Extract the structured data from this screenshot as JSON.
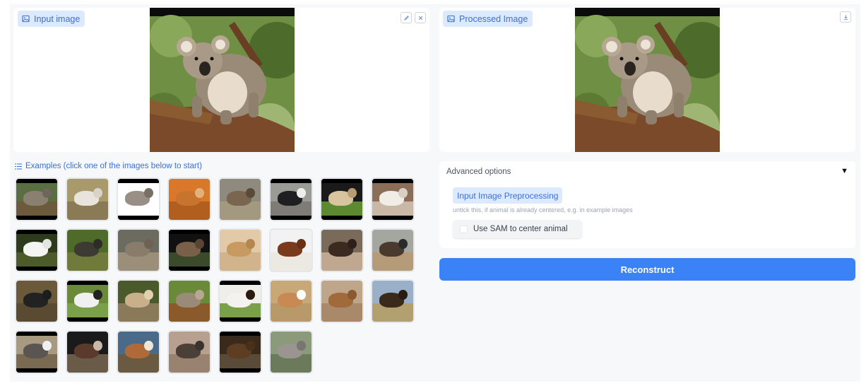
{
  "input_panel": {
    "label": "Input image",
    "icon": "image-icon",
    "edit_icon": "pencil-icon",
    "clear_icon": "close-icon"
  },
  "output_panel": {
    "label": "Processed Image",
    "icon": "image-icon",
    "download_icon": "download-icon"
  },
  "examples": {
    "label": "Examples (click one of the images below to start)",
    "icon": "list-icon",
    "items": [
      {
        "name": "boar",
        "sky": "#5a6e44",
        "ground": "#6b5a3c",
        "body": "#8a8070",
        "head": "#6e665c",
        "bars": true
      },
      {
        "name": "sheep",
        "sky": "#a89a6b",
        "ground": "#8a7a55",
        "body": "#e8e4dc",
        "head": "#d8d2c8",
        "bars": false
      },
      {
        "name": "anteater",
        "sky": "#ffffff",
        "ground": "#ffffff",
        "body": "#9a8f85",
        "head": "#7a6f65",
        "bars": true
      },
      {
        "name": "weasel",
        "sky": "#d9772a",
        "ground": "#b15e1f",
        "body": "#c8742e",
        "head": "#e3b27c",
        "bars": false
      },
      {
        "name": "bighorn",
        "sky": "#8f8a7e",
        "ground": "#a39880",
        "body": "#7a6650",
        "head": "#5a4a38",
        "bars": false
      },
      {
        "name": "dog",
        "sky": "#9a9a96",
        "ground": "#7f7c77",
        "body": "#1f1f22",
        "head": "#eeeeee",
        "bars": true
      },
      {
        "name": "zebra-foal",
        "sky": "#1a1a1a",
        "ground": "#5c8a30",
        "body": "#d9c4a0",
        "head": "#b89d74",
        "bars": true
      },
      {
        "name": "goat",
        "sky": "#8a6e5a",
        "ground": "#c9b8a6",
        "body": "#f1ece6",
        "head": "#d9cfc4",
        "bars": true
      },
      {
        "name": "mountain-goat",
        "sky": "#2e3a1c",
        "ground": "#4d5a2a",
        "body": "#f4f4f2",
        "head": "#e4e4e0",
        "bars": true
      },
      {
        "name": "buffalo",
        "sky": "#4f6b2a",
        "ground": "#6f7a3b",
        "body": "#3c3a32",
        "head": "#2e2c26",
        "bars": false
      },
      {
        "name": "wolf",
        "sky": "#6b6b60",
        "ground": "#9b8f7a",
        "body": "#8a7c6a",
        "head": "#6f6253",
        "bars": false
      },
      {
        "name": "capybara",
        "sky": "#111111",
        "ground": "#3a4a2a",
        "body": "#7a6048",
        "head": "#5a4434",
        "bars": true
      },
      {
        "name": "prairie-dog",
        "sky": "#e2c9a8",
        "ground": "#d2b48c",
        "body": "#c79a62",
        "head": "#b3874f",
        "bars": false
      },
      {
        "name": "setter",
        "sky": "#f2f2f2",
        "ground": "#ece8e2",
        "body": "#7a3a1c",
        "head": "#6a2f14",
        "bars": false
      },
      {
        "name": "otter",
        "sky": "#7a6a5a",
        "ground": "#c0a890",
        "body": "#3a2a20",
        "head": "#2e2018",
        "bars": false
      },
      {
        "name": "ostrich",
        "sky": "#a6a6a0",
        "ground": "#b59b78",
        "body": "#4a3a2e",
        "head": "#2a2a2a",
        "bars": false
      },
      {
        "name": "tapir",
        "sky": "#6a5a3a",
        "ground": "#5a4a32",
        "body": "#222222",
        "head": "#1c1c1c",
        "bars": false
      },
      {
        "name": "zebra",
        "sky": "#6a8a3a",
        "ground": "#7aa04a",
        "body": "#f0f0f0",
        "head": "#222222",
        "bars": true
      },
      {
        "name": "lynx",
        "sky": "#4a5a2a",
        "ground": "#8a7a5a",
        "body": "#c9b08a",
        "head": "#e0d0b0",
        "bars": false
      },
      {
        "name": "koala",
        "sky": "#6a8a3a",
        "ground": "#8a5a2a",
        "body": "#9a8a78",
        "head": "#b8a892",
        "bars": false
      },
      {
        "name": "collie",
        "sky": "#f0eeea",
        "ground": "#7aa04a",
        "body": "#f4f2ee",
        "head": "#2a1a10",
        "bars": true
      },
      {
        "name": "gazelle",
        "sky": "#c9a878",
        "ground": "#b89a6a",
        "body": "#c88a52",
        "head": "#ffffff",
        "bars": false
      },
      {
        "name": "impala",
        "sky": "#bfa58a",
        "ground": "#a88a6a",
        "body": "#a06a3a",
        "head": "#8a5a2e",
        "bars": false
      },
      {
        "name": "bison",
        "sky": "#9ab0c8",
        "ground": "#b3a070",
        "body": "#3a2a1c",
        "head": "#2a1c12",
        "bars": false
      },
      {
        "name": "badger",
        "sky": "#a89a80",
        "ground": "#7a6a52",
        "body": "#5a5550",
        "head": "#f0f0f0",
        "bars": true
      },
      {
        "name": "okapi",
        "sky": "#1a1a1a",
        "ground": "#6a5a48",
        "body": "#5a3a2a",
        "head": "#c8b8a8",
        "bars": false
      },
      {
        "name": "pony",
        "sky": "#4a6a8a",
        "ground": "#6a5a42",
        "body": "#b06a3a",
        "head": "#f0e6d8",
        "bars": false
      },
      {
        "name": "fox-kit",
        "sky": "#b8a090",
        "ground": "#9a8270",
        "body": "#4a4038",
        "head": "#3a322c",
        "bars": false
      },
      {
        "name": "beaver",
        "sky": "#3a2a1c",
        "ground": "#5a4a38",
        "body": "#5e3e22",
        "head": "#4a3018",
        "bars": true
      },
      {
        "name": "armadillo",
        "sky": "#8a9a7a",
        "ground": "#6a7a5a",
        "body": "#9a9590",
        "head": "#7a7570",
        "bars": false
      }
    ]
  },
  "advanced": {
    "title": "Advanced options",
    "caret": "▼",
    "preprocess_label": "Input Image Preprocessing",
    "hint": "untick this, if animal is already centered, e.g. in example images",
    "checkbox_label": "Use SAM to center animal",
    "checkbox_checked": false
  },
  "reconstruct_label": "Reconstruct",
  "colors": {
    "accent": "#3b82f6",
    "chip_bg": "#dbeafe",
    "chip_text": "#3b6fd6"
  }
}
